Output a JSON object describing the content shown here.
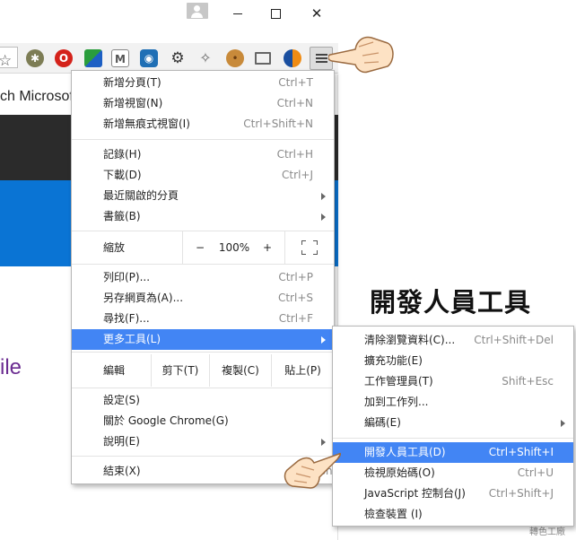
{
  "page": {
    "search_text": "ch Microsoft",
    "partial_text": "ile",
    "caption": "開發人員工具",
    "watermark": "轉色工廠"
  },
  "toolbar": {
    "icons": [
      "star-icon",
      "bug-extension-icon",
      "opera-extension-icon",
      "puzzle-color-extension-icon",
      "gmail-extension-icon",
      "eye-extension-icon",
      "gear-extension-icon",
      "puzzle-extension-icon",
      "cookie-extension-icon",
      "cast-icon",
      "pie-extension-icon",
      "menu-icon"
    ]
  },
  "main_menu": {
    "group1": [
      {
        "label": "新增分頁(T)",
        "shortcut": "Ctrl+T"
      },
      {
        "label": "新增視窗(N)",
        "shortcut": "Ctrl+N"
      },
      {
        "label": "新增無痕式視窗(I)",
        "shortcut": "Ctrl+Shift+N"
      }
    ],
    "group2": [
      {
        "label": "記錄(H)",
        "shortcut": "Ctrl+H"
      },
      {
        "label": "下載(D)",
        "shortcut": "Ctrl+J"
      },
      {
        "label": "最近關啟的分頁",
        "shortcut": ""
      },
      {
        "label": "書籤(B)",
        "shortcut": ""
      }
    ],
    "zoom": {
      "label": "縮放",
      "minus": "−",
      "value": "100%",
      "plus": "+"
    },
    "group3": [
      {
        "label": "列印(P)...",
        "shortcut": "Ctrl+P"
      },
      {
        "label": "另存網頁為(A)...",
        "shortcut": "Ctrl+S"
      },
      {
        "label": "尋找(F)...",
        "shortcut": "Ctrl+F"
      },
      {
        "label": "更多工具(L)",
        "shortcut": ""
      }
    ],
    "edit": {
      "label": "編輯",
      "cut": "剪下(T)",
      "copy": "複製(C)",
      "paste": "貼上(P)"
    },
    "group4": [
      {
        "label": "設定(S)",
        "shortcut": ""
      },
      {
        "label": "關於 Google Chrome(G)",
        "shortcut": ""
      },
      {
        "label": "說明(E)",
        "shortcut": ""
      }
    ],
    "exit": {
      "label": "結束(X)",
      "shortcut": "Ctrl+Shi"
    }
  },
  "sub_menu": {
    "group1": [
      {
        "label": "清除瀏覽資料(C)...",
        "shortcut": "Ctrl+Shift+Del"
      },
      {
        "label": "擴充功能(E)",
        "shortcut": ""
      },
      {
        "label": "工作管理員(T)",
        "shortcut": "Shift+Esc"
      },
      {
        "label": "加到工作列...",
        "shortcut": ""
      },
      {
        "label": "編碼(E)",
        "shortcut": ""
      }
    ],
    "group2": [
      {
        "label": "開發人員工具(D)",
        "shortcut": "Ctrl+Shift+I"
      },
      {
        "label": "檢視原始碼(O)",
        "shortcut": "Ctrl+U"
      },
      {
        "label": "JavaScript 控制台(J)",
        "shortcut": "Ctrl+Shift+J"
      },
      {
        "label": "檢查裝置 (I)",
        "shortcut": ""
      }
    ]
  },
  "colors": {
    "highlight": "#4285f4",
    "caption": "#111111",
    "partial_text": "#6b2c91",
    "blue_band": "#0a74d4",
    "dark_band": "#2b2b2b"
  }
}
